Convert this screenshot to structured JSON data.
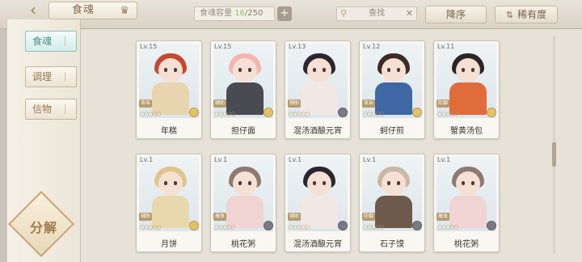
{
  "header": {
    "title": "食魂",
    "capacity_label": "食魂容量",
    "capacity_current": "16",
    "capacity_total": "/250",
    "search_placeholder": "查找",
    "sort_label": "降序",
    "rarity_label": "稀有度"
  },
  "sidebar": {
    "tabs": [
      {
        "label": "食魂"
      },
      {
        "label": "调理"
      },
      {
        "label": "信物"
      }
    ],
    "decompose_label": "分解"
  },
  "cards": [
    {
      "level": "Lv.15",
      "role": "攻击",
      "name": "年糕",
      "hair": "#c34a2f",
      "body": "#e9d4b0",
      "elem": "gold"
    },
    {
      "level": "Lv.15",
      "role": "辅助",
      "name": "担仔面",
      "hair": "#f4b5b0",
      "body": "#4a4a52",
      "elem": "gold"
    },
    {
      "level": "Lv.13",
      "role": "辅助",
      "name": "混汤酒酿元宵",
      "hair": "#2c2530",
      "body": "#f1e7e4",
      "elem": "grey"
    },
    {
      "level": "Lv.12",
      "role": "攻击",
      "name": "蚵仔煎",
      "hair": "#3b2c26",
      "body": "#3e67a4",
      "elem": "gold"
    },
    {
      "level": "Lv.11",
      "role": "防御",
      "name": "蟹黄汤包",
      "hair": "#2b2526",
      "body": "#e16c3b",
      "elem": "gold"
    },
    {
      "level": "Lv.1",
      "role": "辅助",
      "name": "月饼",
      "hair": "#e0c48c",
      "body": "#ead8ad",
      "elem": "gold"
    },
    {
      "level": "Lv.1",
      "role": "爆发",
      "name": "桃花粥",
      "hair": "#8d7a72",
      "body": "#f0d4d3",
      "elem": "grey"
    },
    {
      "level": "Lv.1",
      "role": "辅助",
      "name": "混汤酒酿元宵",
      "hair": "#2c2530",
      "body": "#f1e7e4",
      "elem": "grey"
    },
    {
      "level": "Lv.1",
      "role": "防御",
      "name": "石子馍",
      "hair": "#c9b8a6",
      "body": "#6e5a4b",
      "elem": "grey"
    },
    {
      "level": "Lv.1",
      "role": "爆发",
      "name": "桃花粥",
      "hair": "#8d7a72",
      "body": "#f0d4d3",
      "elem": "grey"
    }
  ],
  "icons": {
    "back": "back-arrow-icon",
    "crown": "crown-icon",
    "search": "magnifier-icon",
    "clear": "clear-icon",
    "sort": "sort-icon"
  }
}
